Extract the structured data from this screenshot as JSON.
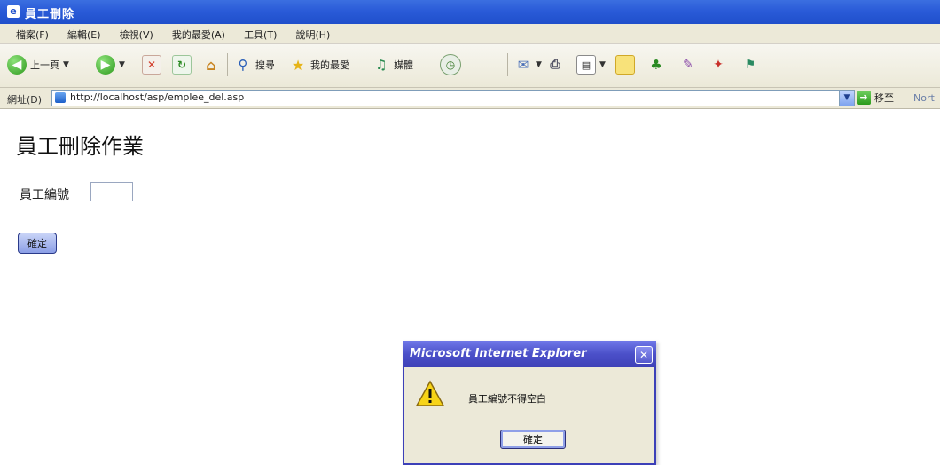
{
  "window": {
    "title": "員工刪除"
  },
  "menu": {
    "items": [
      "檔案(F)",
      "編輯(E)",
      "檢視(V)",
      "我的最愛(A)",
      "工具(T)",
      "說明(H)"
    ]
  },
  "toolbar": {
    "back_label": "上一頁",
    "search_label": "搜尋",
    "favorites_label": "我的最愛",
    "media_label": "媒體"
  },
  "address": {
    "label": "網址(D)",
    "url": "http://localhost/asp/emplee_del.asp",
    "go_label": "移至",
    "links_label": "Nort"
  },
  "page": {
    "title": "員工刪除作業",
    "field_label": "員工編號",
    "field_value": "",
    "submit_label": "確定"
  },
  "dialog": {
    "title": "Microsoft Internet Explorer",
    "close_glyph": "✕",
    "message": "員工編號不得空白",
    "ok_label": "確定"
  }
}
